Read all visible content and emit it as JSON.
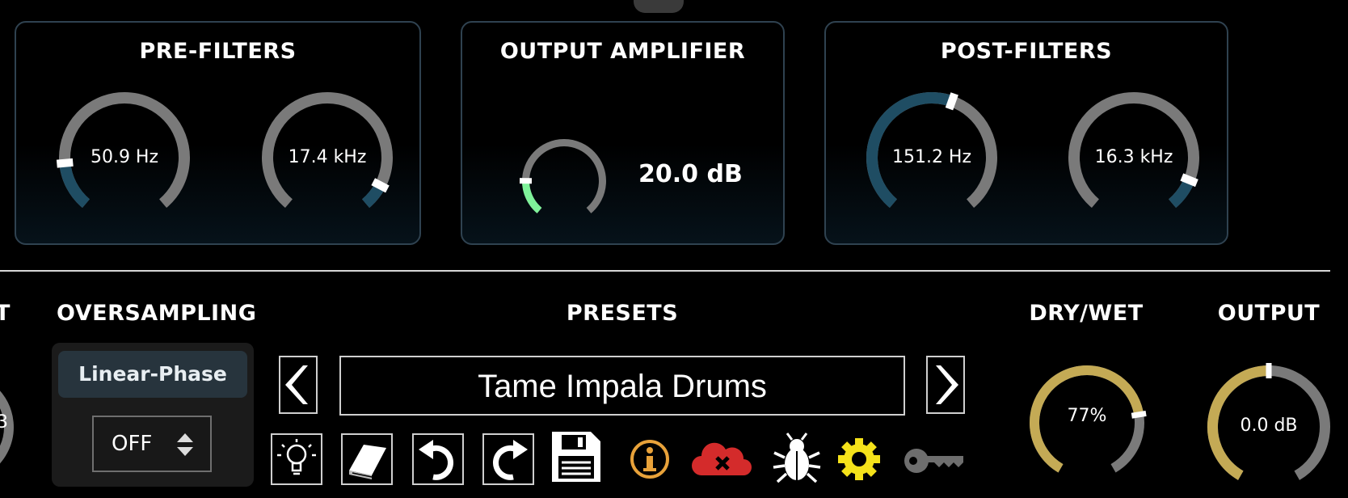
{
  "pre_filters": {
    "title": "PRE-FILTERS",
    "low_cut": {
      "value": "50.9 Hz",
      "level": 0.16
    },
    "high_cut": {
      "value": "17.4 kHz",
      "level": 0.92
    }
  },
  "output_amplifier": {
    "title": "OUTPUT AMPLIFIER",
    "gain": {
      "value": "20.0 dB",
      "level": 0.18
    }
  },
  "post_filters": {
    "title": "POST-FILTERS",
    "low_cut": {
      "value": "151.2 Hz",
      "level": 0.57
    },
    "high_cut": {
      "value": "16.3 kHz",
      "level": 0.9
    }
  },
  "oversampling": {
    "title": "OVERSAMPLING",
    "mode_button": "Linear-Phase",
    "selector_value": "OFF"
  },
  "left_partial": {
    "title_fragment": "T",
    "knob_value_fragment": "3"
  },
  "presets": {
    "title": "PRESETS",
    "current": "Tame Impala Drums"
  },
  "toolbar": {
    "icons": [
      "lightbulb-icon",
      "book-icon",
      "undo-icon",
      "redo-icon",
      "save-icon",
      "info-icon",
      "cloud-error-icon",
      "bug-icon",
      "gear-icon",
      "key-icon"
    ],
    "info_color": "#e8a23a",
    "cloud_color": "#d42b2b",
    "gear_color": "#f5e21a",
    "key_color": "#6e6e6e"
  },
  "dry_wet": {
    "title": "DRY/WET",
    "value": "77%",
    "level": 0.77
  },
  "output": {
    "title": "OUTPUT",
    "value": "0.0 dB",
    "level": 0.5
  },
  "colors": {
    "filter_arc": "#1f4d63",
    "amp_arc": "#7ff29a",
    "gold_arc": "#c4aa55",
    "track": "#7a7a7a",
    "panel_border": "#2f4250"
  }
}
